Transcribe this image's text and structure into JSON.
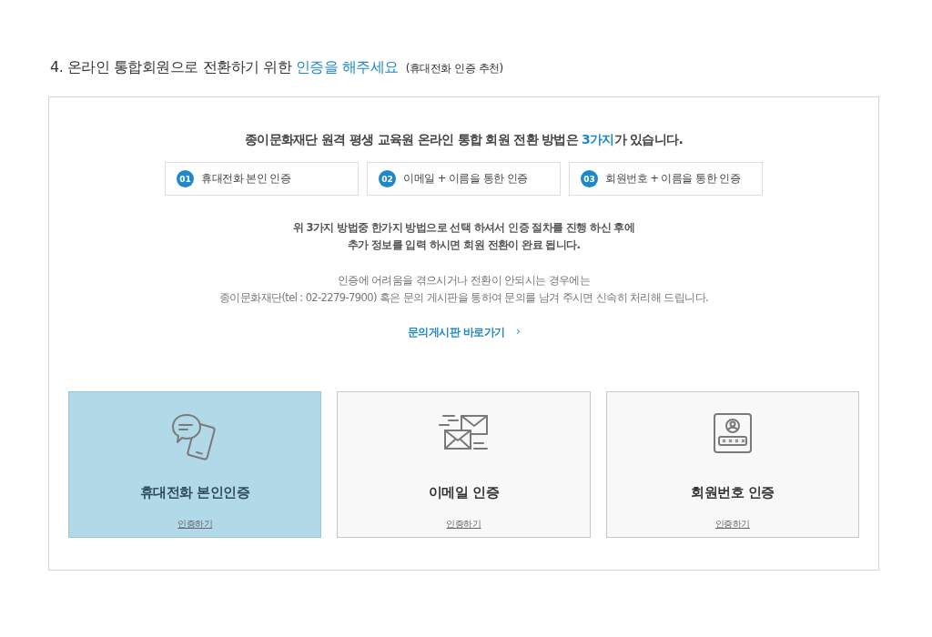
{
  "heading": {
    "segments": [
      {
        "text": "4. 온라인 통합회원으로 전환하기 위한 ",
        "accent": false
      },
      {
        "text": "인증을 해주세요",
        "accent": true
      }
    ],
    "note": "(휴대전화 인증 추천)"
  },
  "intro": {
    "segments": [
      {
        "text": "종이문화재단 원격 평생 교육원 온라인 통합 회원 전환 방법은 ",
        "accent": false
      },
      {
        "text": "3가지",
        "accent": true
      },
      {
        "text": "가 있습니다.",
        "accent": false
      }
    ]
  },
  "methods": [
    {
      "number": "01",
      "label": "휴대전화 본인 인증"
    },
    {
      "number": "02",
      "label": "이메일 + 이름을 통한 인증"
    },
    {
      "number": "03",
      "label": "회원번호 + 이름을 통한 인증"
    }
  ],
  "instructions": [
    "위 3가지 방법중 한가지 방법으로 선택 하셔서 인증 절차를 진행 하신 후에",
    "추가 정보를 입력 하시면 회원 전환이 완료 됩니다."
  ],
  "help": [
    "인증에 어려움을 겪으시거나 전환이 안되시는 경우에는",
    "종이문화재단(tel : 02-2279-7900) 혹은 문의 게시판을 통하여 문의를 남겨 주시면 신속히 처리해 드립니다."
  ],
  "board_link": {
    "label": "문의게시판 바로가기",
    "arrow": "›"
  },
  "cards": [
    {
      "kind": "phone",
      "title": "휴대전화 본인인증",
      "action": "인증하기",
      "selected": true
    },
    {
      "kind": "email",
      "title": "이메일 인증",
      "action": "인증하기",
      "selected": false
    },
    {
      "kind": "member",
      "title": "회원번호 인증",
      "action": "인증하기",
      "selected": false
    }
  ]
}
